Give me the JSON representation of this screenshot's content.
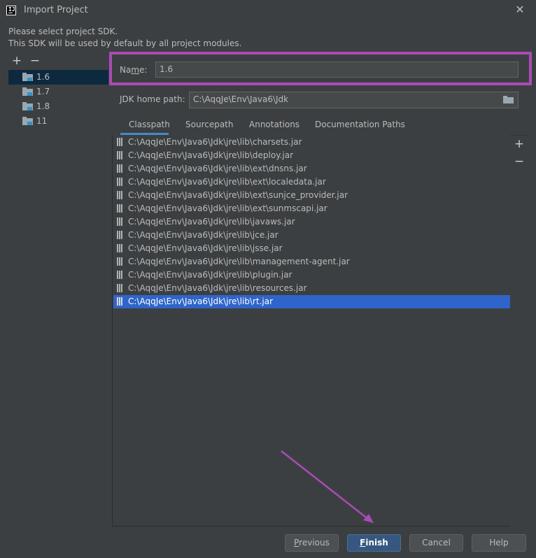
{
  "window": {
    "title": "Import Project"
  },
  "instructions": {
    "line1": "Please select project SDK.",
    "line2": "This SDK will be used by default by all project modules."
  },
  "sdk_list": {
    "items": [
      "1.6",
      "1.7",
      "1.8",
      "11"
    ],
    "selected": "1.6"
  },
  "name_field": {
    "label_pre": "Na",
    "label_mnemonic": "m",
    "label_post": "e:",
    "value": "1.6"
  },
  "jdk_home": {
    "label": "JDK home path:",
    "value": "C:\\AqqJe\\Env\\Java6\\Jdk"
  },
  "tabs": [
    "Classpath",
    "Sourcepath",
    "Annotations",
    "Documentation Paths"
  ],
  "active_tab": "Classpath",
  "classpath": [
    "C:\\AqqJe\\Env\\Java6\\Jdk\\jre\\lib\\charsets.jar",
    "C:\\AqqJe\\Env\\Java6\\Jdk\\jre\\lib\\deploy.jar",
    "C:\\AqqJe\\Env\\Java6\\Jdk\\jre\\lib\\ext\\dnsns.jar",
    "C:\\AqqJe\\Env\\Java6\\Jdk\\jre\\lib\\ext\\localedata.jar",
    "C:\\AqqJe\\Env\\Java6\\Jdk\\jre\\lib\\ext\\sunjce_provider.jar",
    "C:\\AqqJe\\Env\\Java6\\Jdk\\jre\\lib\\ext\\sunmscapi.jar",
    "C:\\AqqJe\\Env\\Java6\\Jdk\\jre\\lib\\javaws.jar",
    "C:\\AqqJe\\Env\\Java6\\Jdk\\jre\\lib\\jce.jar",
    "C:\\AqqJe\\Env\\Java6\\Jdk\\jre\\lib\\jsse.jar",
    "C:\\AqqJe\\Env\\Java6\\Jdk\\jre\\lib\\management-agent.jar",
    "C:\\AqqJe\\Env\\Java6\\Jdk\\jre\\lib\\plugin.jar",
    "C:\\AqqJe\\Env\\Java6\\Jdk\\jre\\lib\\resources.jar",
    "C:\\AqqJe\\Env\\Java6\\Jdk\\jre\\lib\\rt.jar"
  ],
  "classpath_selected": "C:\\AqqJe\\Env\\Java6\\Jdk\\jre\\lib\\rt.jar",
  "buttons": {
    "previous": {
      "mnemonic": "P",
      "rest": "revious"
    },
    "finish": {
      "mnemonic": "F",
      "rest": "inish"
    },
    "cancel": "Cancel",
    "help": "Help"
  },
  "icons": {
    "app": "intellij-icon",
    "close": "close-icon",
    "add": "plus-icon",
    "remove": "minus-icon",
    "sdk": "folder-icon",
    "browse": "folder-icon",
    "jar": "jar-icon"
  },
  "colors": {
    "background": "#3c3f41",
    "selection": "#2f65ca",
    "sdk_selection": "#0d293e",
    "default_button": "#365880",
    "annotation": "#a94bb5"
  }
}
